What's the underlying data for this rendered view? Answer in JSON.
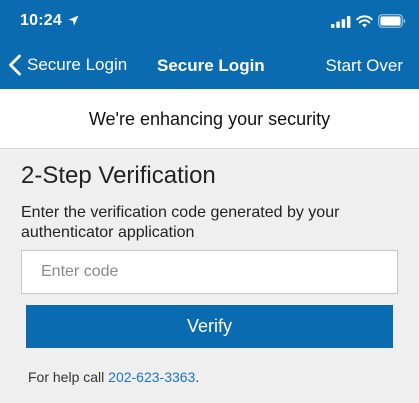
{
  "status_bar": {
    "time": "10:24",
    "icons": [
      "location-arrow-icon",
      "signal-icon",
      "wifi-icon",
      "battery-icon"
    ]
  },
  "nav": {
    "back_label": "Secure Login",
    "title": "Secure Login",
    "start_over": "Start Over"
  },
  "banner": {
    "text": "We're enhancing your security"
  },
  "verification": {
    "title": "2-Step Verification",
    "instructions": "Enter the verification code generated by your authenticator application",
    "code_placeholder": "Enter code",
    "code_value": "",
    "verify_label": "Verify"
  },
  "help": {
    "prefix": "For help call ",
    "phone": "202-623-3363",
    "suffix": "."
  },
  "colors": {
    "brand_blue": "#0b6bb0",
    "link_blue": "#1a74c9",
    "background": "#efeff0"
  }
}
